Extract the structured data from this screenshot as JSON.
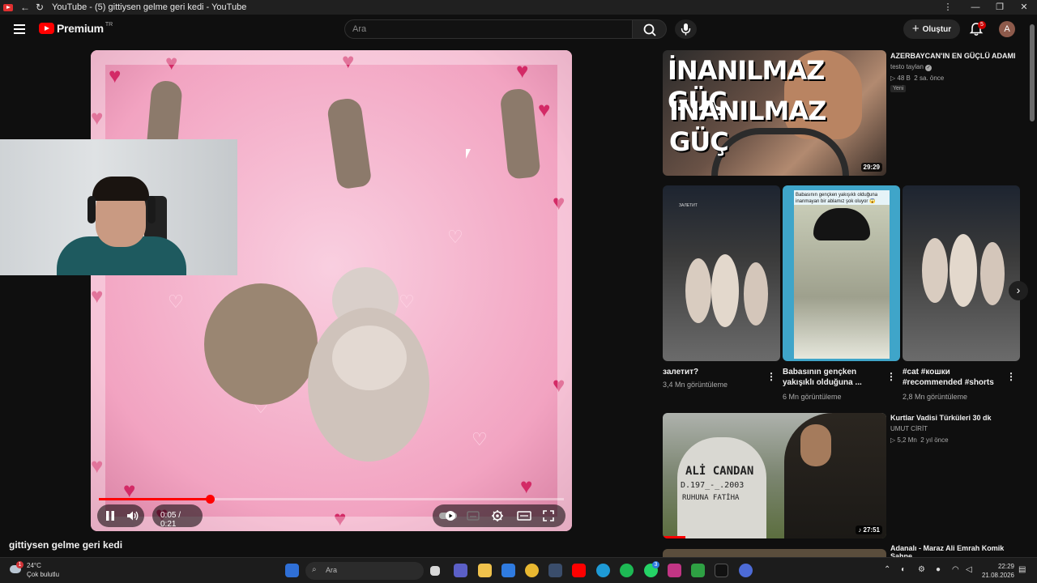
{
  "browser": {
    "tab_title": "YouTube - (5) gittiysen gelme geri kedi - YouTube",
    "min_glyph": "—",
    "max_glyph": "❐",
    "close_glyph": "✕",
    "more_glyph": "⋮"
  },
  "header": {
    "logo_text": "Premium",
    "logo_region": "TR",
    "search_placeholder": "Ara",
    "create_label": "Oluştur",
    "notification_count": "5",
    "avatar_letter": "A"
  },
  "player": {
    "time": "0:05 / 0:21",
    "progress": 0.238
  },
  "video": {
    "title": "gittiysen gelme geri kedi"
  },
  "recommendations": [
    {
      "title": "AZERBAYCAN'IN EN GÜÇLÜ ADAMI",
      "channel": "testo taylan",
      "views": "48 B",
      "age": "2 sa. önce",
      "badge": "Yeni",
      "duration": "29:29",
      "thumb_text_1": "İNANILMAZ GÜÇ",
      "thumb_text_2": "İNANILMAZ GÜÇ"
    },
    {
      "title": "Kurtlar Vadisi Türküleri 30 dk",
      "channel": "UMUT CİRİT",
      "views": "5,2 Mn",
      "age": "2 yıl önce",
      "duration": "27:51",
      "thumb_text_1": "ALİ CANDAN",
      "thumb_text_2": "D.197_-_.2003",
      "thumb_text_3": "RUHUNA FATİHA"
    },
    {
      "title": "Adanalı - Maraz Ali Emrah Komik Sahne"
    }
  ],
  "shorts": [
    {
      "title": "залетит?",
      "views": "3,4 Mn görüntüleme",
      "overlay_caption": "ЗАЛЕТИТ"
    },
    {
      "title": "Babasının gençken yakışıklı olduğuna ...",
      "views": "6 Mn görüntüleme",
      "overlay_caption": "Babasının gençken yakışıklı olduğuna inanmayan bir ablamız şok oluyor 😱"
    },
    {
      "title": "#cat #кошки #recommended #shorts",
      "views": "2,8 Mn görüntüleme"
    }
  ],
  "taskbar": {
    "weather_badge": "1",
    "temperature": "24°C",
    "weather": "Çok bulutlu",
    "search_placeholder": "Ara",
    "whatsapp_badge": "3",
    "time": "22:29",
    "date": "21.08.2026"
  },
  "colors": {
    "background": "#0f0f0f",
    "accent_red": "#ff0000",
    "secondary_text": "#aaaaaa"
  }
}
